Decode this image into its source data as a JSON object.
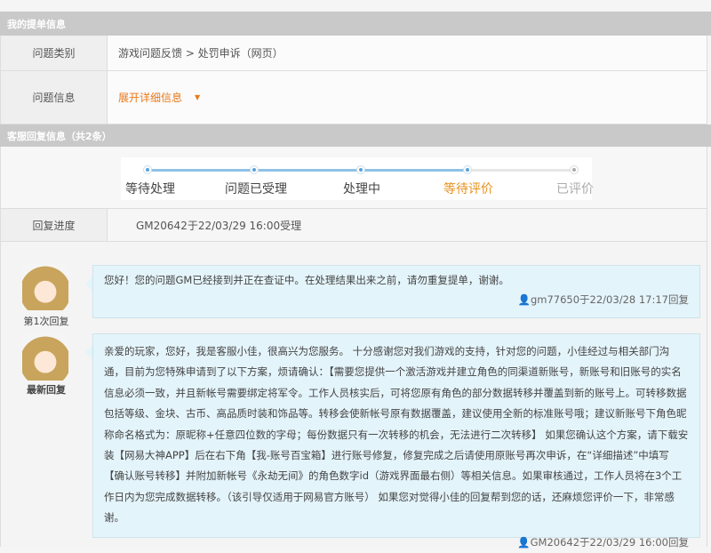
{
  "ticket_section": {
    "title": "我的提单信息",
    "category_label": "问题类别",
    "category_value": "游戏问题反馈 > 处罚申诉（网页）",
    "info_label": "问题信息",
    "expand_link": "展开详细信息",
    "expand_icon": "▼"
  },
  "reply_section": {
    "title": "客服回复信息（共2条）"
  },
  "progress": {
    "steps": [
      "等待处理",
      "问题已受理",
      "处理中",
      "等待评价",
      "已评价"
    ],
    "current_step": 3,
    "label": "回复进度",
    "value": "GM20642于22/03/29 16:00受理"
  },
  "replies": [
    {
      "avatar_label": "第1次回复",
      "text": "您好！您的问题GM已经接到并正在查证中。在处理结果出来之前，请勿重复提单，谢谢。",
      "signature": "gm77650于22/03/28 17:17回复"
    },
    {
      "avatar_label": "最新回复",
      "text": "亲爱的玩家，您好，我是客服小佳，很高兴为您服务。 十分感谢您对我们游戏的支持，针对您的问题，小佳经过与相关部门沟通，目前为您特殊申请到了以下方案，烦请确认：【需要您提供一个激活游戏并建立角色的同渠道新账号，新账号和旧账号的实名信息必须一致，并且新帐号需要绑定将军令。工作人员核实后，可将您原有角色的部分数据转移并覆盖到新的账号上。可转移数据包括等级、金块、古币、高品质时装和饰品等。转移会使新帐号原有数据覆盖，建议使用全新的标准账号哦；建议新账号下角色昵称命名格式为：原昵称+任意四位数的字母；每份数据只有一次转移的机会，无法进行二次转移】 如果您确认这个方案，请下载安装【网易大神APP】后在右下角【我-账号百宝箱】进行账号修复，修复完成之后请使用原账号再次申诉，在“详细描述”中填写【确认账号转移】并附加新帐号《永劫无间》的角色数字id（游戏界面最右侧）等相关信息。如果审核通过，工作人员将在3个工作日内为您完成数据转移。（该引导仅适用于网易官方账号） 如果您对觉得小佳的回复帮到您的话，还麻烦您评价一下，非常感谢。",
      "signature": "GM20642于22/03/29 16:00回复"
    }
  ],
  "colors": {
    "accent": "#e8791b",
    "progress": "#5aa2d8",
    "header": "#c9c9c9",
    "bubble": "#e4f4fb"
  }
}
